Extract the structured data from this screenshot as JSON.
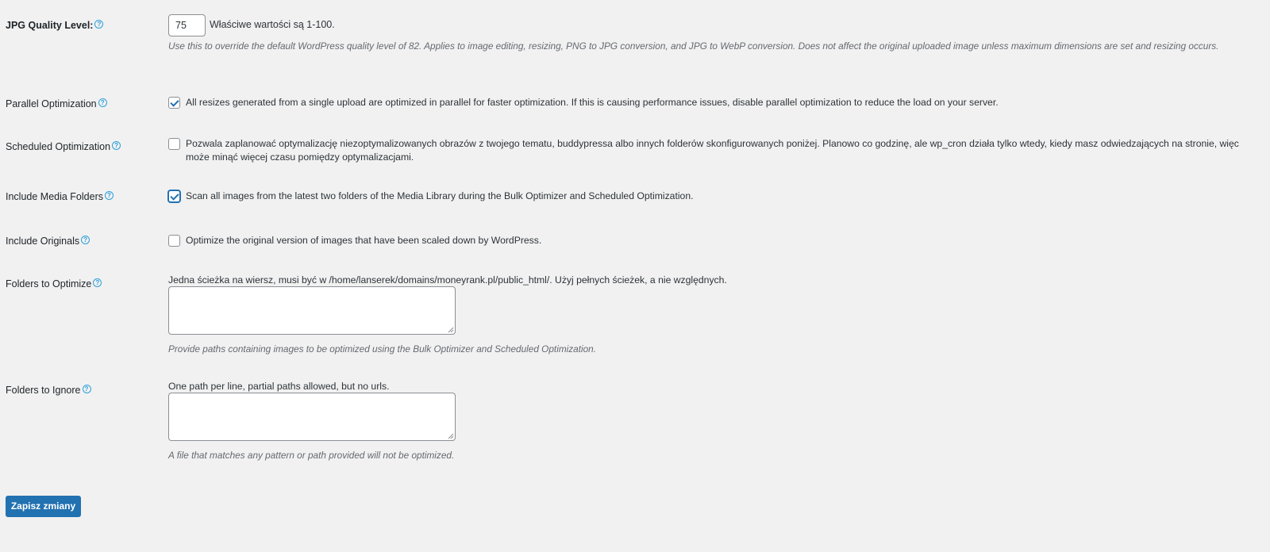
{
  "settings": {
    "jpg_quality": {
      "label": "JPG Quality Level:",
      "value": "75",
      "inline_text": "Właściwe wartości są 1-100.",
      "description": "Use this to override the default WordPress quality level of 82. Applies to image editing, resizing, PNG to JPG conversion, and JPG to WebP conversion. Does not affect the original uploaded image unless maximum dimensions are set and resizing occurs."
    },
    "parallel": {
      "label": "Parallel Optimization",
      "checked": true,
      "text": "All resizes generated from a single upload are optimized in parallel for faster optimization. If this is causing performance issues, disable parallel optimization to reduce the load on your server."
    },
    "scheduled": {
      "label": "Scheduled Optimization",
      "checked": false,
      "text": "Pozwala zaplanować optymalizację niezoptymalizowanych obrazów z twojego tematu, buddypressa albo innych folderów skonfigurowanych poniżej. Planowo co godzinę, ale wp_cron działa tylko wtedy, kiedy masz odwiedzających na stronie, więc może minąć więcej czasu pomiędzy optymalizacjami."
    },
    "media_folders": {
      "label": "Include Media Folders",
      "checked": true,
      "text": "Scan all images from the latest two folders of the Media Library during the Bulk Optimizer and Scheduled Optimization."
    },
    "originals": {
      "label": "Include Originals",
      "checked": false,
      "text": "Optimize the original version of images that have been scaled down by WordPress."
    },
    "folders_optimize": {
      "label": "Folders to Optimize",
      "hint": "Jedna ścieżka na wiersz, musi być w /home/lanserek/domains/moneyrank.pl/public_html/. Użyj pełnych ścieżek, a nie względnych.",
      "value": "",
      "description": "Provide paths containing images to be optimized using the Bulk Optimizer and Scheduled Optimization."
    },
    "folders_ignore": {
      "label": "Folders to Ignore",
      "hint": "One path per line, partial paths allowed, but no urls.",
      "value": "",
      "description": "A file that matches any pattern or path provided will not be optimized."
    }
  },
  "help_icon": "question-circle-icon",
  "help_glyph": "?",
  "submit_label": "Zapisz zmiany",
  "colors": {
    "accent": "#2271b1",
    "help": "#2d9fd9",
    "background": "#f1f1f1"
  }
}
